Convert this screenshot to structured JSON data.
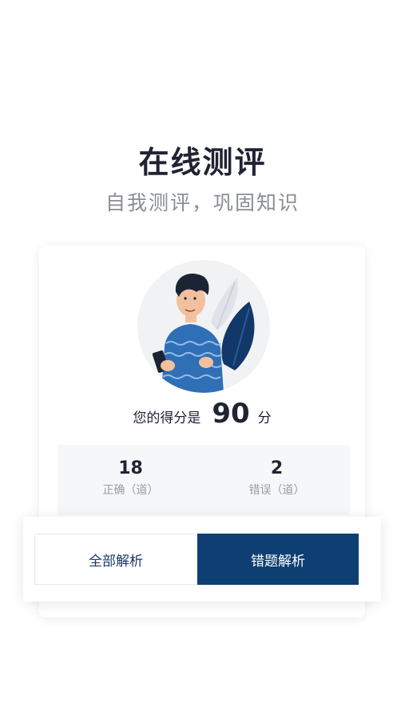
{
  "header": {
    "title": "在线测评",
    "subtitle": "自我测评，巩固知识"
  },
  "result": {
    "score_label": "您的得分是",
    "score_value": "90",
    "score_unit": "分",
    "correct_count": "18",
    "correct_label": "正确（道）",
    "wrong_count": "2",
    "wrong_label": "错误（道）"
  },
  "actions": {
    "all_analysis": "全部解析",
    "wrong_analysis": "错题解析"
  },
  "colors": {
    "primary": "#0e3f73",
    "title_text": "#1f2333",
    "muted_text": "#8a8d96"
  }
}
